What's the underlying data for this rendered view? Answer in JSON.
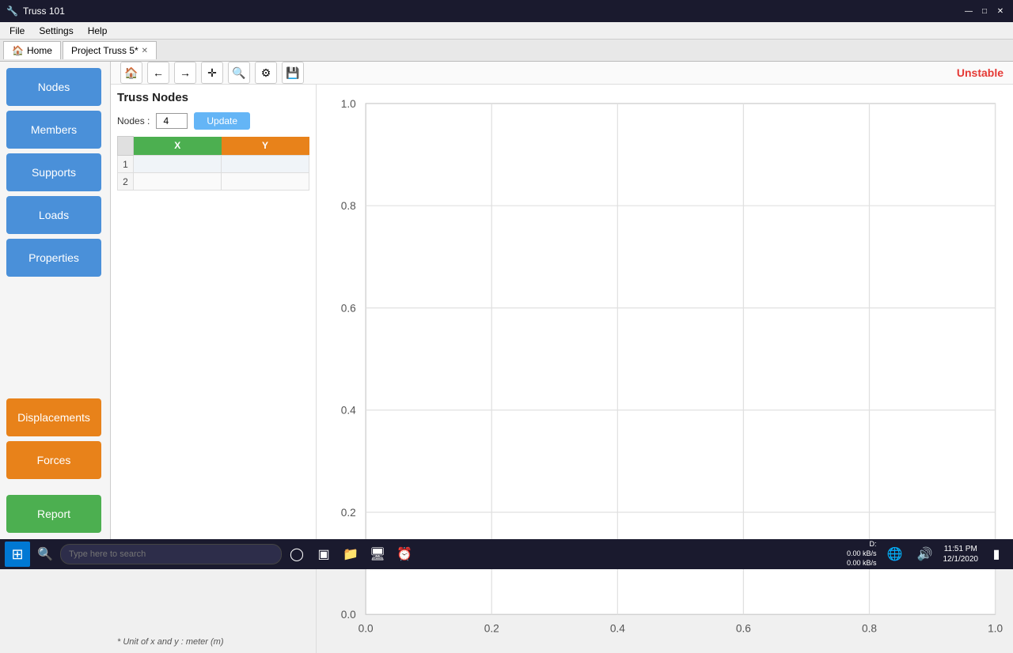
{
  "titleBar": {
    "title": "Truss 101",
    "controls": {
      "minimize": "—",
      "maximize": "□",
      "close": "✕"
    }
  },
  "menuBar": {
    "items": [
      "File",
      "Settings",
      "Help"
    ]
  },
  "tabs": {
    "home": {
      "label": "Home",
      "icon": "🏠"
    },
    "project": {
      "label": "Project Truss 5*",
      "closable": true
    }
  },
  "sidebar": {
    "topButtons": [
      {
        "id": "nodes",
        "label": "Nodes",
        "color": "blue"
      },
      {
        "id": "members",
        "label": "Members",
        "color": "blue"
      },
      {
        "id": "supports",
        "label": "Supports",
        "color": "blue"
      },
      {
        "id": "loads",
        "label": "Loads",
        "color": "blue"
      },
      {
        "id": "properties",
        "label": "Properties",
        "color": "blue"
      }
    ],
    "bottomButtons": [
      {
        "id": "displacements",
        "label": "Displacements",
        "color": "orange"
      },
      {
        "id": "forces",
        "label": "Forces",
        "color": "orange"
      }
    ],
    "reportButton": {
      "label": "Report",
      "color": "green"
    }
  },
  "toolbar": {
    "icons": [
      {
        "name": "home-icon",
        "symbol": "🏠"
      },
      {
        "name": "back-icon",
        "symbol": "←"
      },
      {
        "name": "forward-icon",
        "symbol": "→"
      },
      {
        "name": "move-icon",
        "symbol": "✛"
      },
      {
        "name": "search-icon",
        "symbol": "🔍"
      },
      {
        "name": "settings-icon",
        "symbol": "⚙"
      },
      {
        "name": "save-icon",
        "symbol": "💾"
      }
    ],
    "unstable": "Unstable"
  },
  "panel": {
    "title": "Truss Nodes",
    "nodesLabel": "Nodes :",
    "nodesValue": "4",
    "updateLabel": "Update",
    "table": {
      "headers": [
        "X",
        "Y"
      ],
      "rows": [
        {
          "num": "1",
          "x": "",
          "y": ""
        },
        {
          "num": "2",
          "x": "",
          "y": ""
        }
      ]
    },
    "unitNote": "* Unit of x and y : meter (m)"
  },
  "chart": {
    "xLabels": [
      "0.0",
      "0.2",
      "0.4",
      "0.6",
      "0.8",
      "1.0"
    ],
    "yLabels": [
      "0.0",
      "0.2",
      "0.4",
      "0.6",
      "0.8",
      "1.0"
    ],
    "gridLines": 5
  },
  "taskbar": {
    "searchPlaceholder": "Type here to search",
    "icons": [
      "⊞",
      "🗂",
      "📁",
      "🖥",
      "⏰"
    ],
    "network": {
      "line1": "0.00 kB/s",
      "line2": "0.00 kB/s",
      "label": "D:"
    },
    "time": "11:51 PM",
    "date": "12/1/2020"
  }
}
